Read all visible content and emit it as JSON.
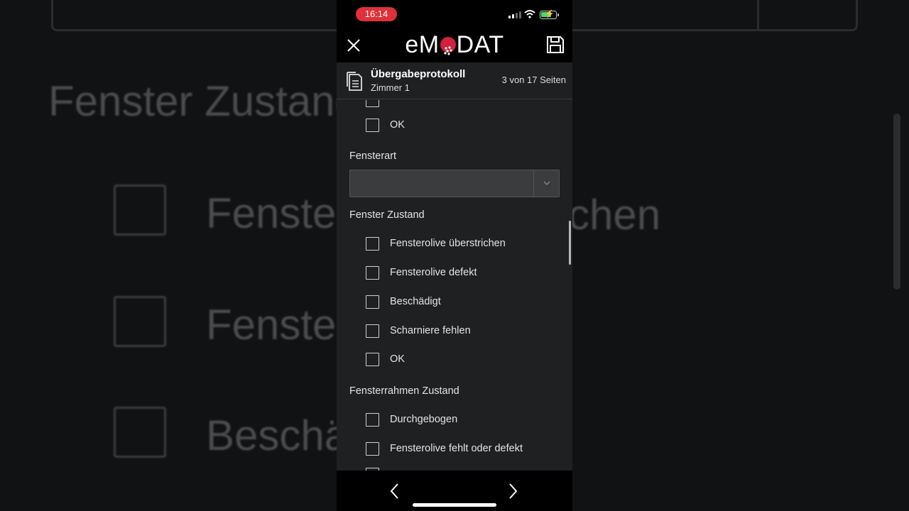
{
  "status": {
    "time": "16:14"
  },
  "app": {
    "logo_left": "eM",
    "logo_right": "DAT"
  },
  "header": {
    "title": "Übergabeprotokoll",
    "room": "Zimmer 1",
    "pages": "3 von 17 Seiten"
  },
  "content": {
    "ok_prev": "OK",
    "fensterart_label": "Fensterart",
    "fensterart_value": "",
    "fenster_zustand": {
      "label": "Fenster Zustand",
      "items": [
        "Fensterolive überstrichen",
        "Fensterolive defekt",
        "Beschädigt",
        "Scharniere fehlen",
        "OK"
      ]
    },
    "rahmen_zustand": {
      "label": "Fensterrahmen Zustand",
      "items": [
        "Durchgebogen",
        "Fensterolive fehlt oder defekt"
      ]
    }
  },
  "background": {
    "title": "Fenster Zustand",
    "item1": "Fenster",
    "item1_suffix": "chen",
    "item2": "Fenster",
    "item3": "Beschä"
  },
  "colors": {
    "time_pill": "#e0303a",
    "logo_dot": "#d0213e",
    "battery": "#4cd964"
  }
}
